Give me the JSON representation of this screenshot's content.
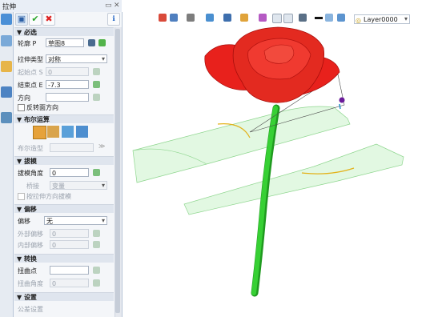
{
  "window": {
    "title": "拉伸"
  },
  "panel": {
    "sections": {
      "required": "必选",
      "boolean": "布尔运算",
      "draft": "拔模",
      "offset": "偏移",
      "transform": "转换",
      "settings": "设置"
    },
    "required": {
      "profile_label": "轮廓 P",
      "profile_value": "草图8",
      "extrude_type_label": "拉伸类型",
      "extrude_type_value": "对称",
      "start_label": "起始点 S",
      "start_value": "0",
      "end_label": "结束点 E",
      "end_value": "-7.3",
      "direction_label": "方向",
      "flip_label": "反转面方向"
    },
    "boolean": {
      "body_label": "布尔造型"
    },
    "draft": {
      "angle_label": "拔模角度",
      "angle_value": "0",
      "edge_label": "桥接",
      "edge_value": "变量",
      "reverse_label": "按拉伸方向拔模"
    },
    "offset": {
      "offset_label": "偏移",
      "offset_value": "无",
      "outer_label": "外部偏移",
      "outer_value": "0",
      "inner_label": "内部偏移",
      "inner_value": "0"
    },
    "transform": {
      "twist_point_label": "扭曲点",
      "twist_angle_label": "扭曲角度",
      "twist_angle_value": "0"
    },
    "settings": {
      "item_label": "公差设置"
    }
  },
  "toolbar": {
    "layer_value": "Layer0000"
  },
  "colors": {
    "petal": "#e8211c",
    "stem": "#2fc12b",
    "surface": "#bff0bf",
    "panel_bg": "#f4f6f9",
    "accent_blue": "#2e6fc4"
  }
}
